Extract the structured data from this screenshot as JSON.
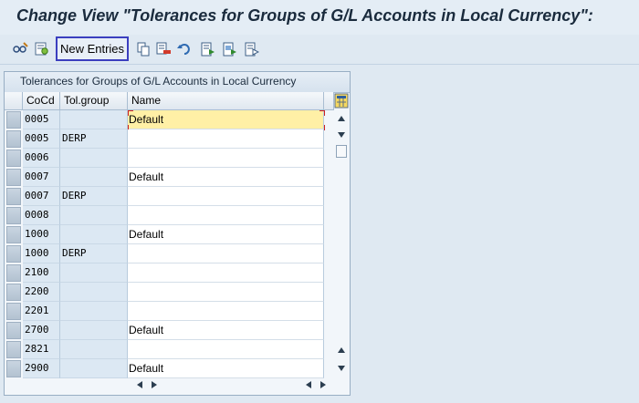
{
  "window": {
    "title": "Change View \"Tolerances for Groups of G/L Accounts in Local Currency\":"
  },
  "toolbar": {
    "new_entries_label": "New Entries",
    "icons": [
      "display-change-icon",
      "other-view-icon",
      "new-entries-button",
      "copy-icon",
      "delete-icon",
      "undo-icon",
      "select-all-icon",
      "select-block-icon",
      "deselect-all-icon"
    ]
  },
  "table": {
    "title": "Tolerances for Groups of G/L Accounts in Local Currency",
    "columns": [
      "CoCd",
      "Tol.group",
      "Name"
    ],
    "rows": [
      {
        "cocd": "0005",
        "tol_group": "",
        "name": "Default"
      },
      {
        "cocd": "0005",
        "tol_group": "DERP",
        "name": ""
      },
      {
        "cocd": "0006",
        "tol_group": "",
        "name": ""
      },
      {
        "cocd": "0007",
        "tol_group": "",
        "name": "Default"
      },
      {
        "cocd": "0007",
        "tol_group": "DERP",
        "name": ""
      },
      {
        "cocd": "0008",
        "tol_group": "",
        "name": ""
      },
      {
        "cocd": "1000",
        "tol_group": "",
        "name": "Default"
      },
      {
        "cocd": "1000",
        "tol_group": "DERP",
        "name": ""
      },
      {
        "cocd": "2100",
        "tol_group": "",
        "name": ""
      },
      {
        "cocd": "2200",
        "tol_group": "",
        "name": ""
      },
      {
        "cocd": "2201",
        "tol_group": "",
        "name": ""
      },
      {
        "cocd": "2700",
        "tol_group": "",
        "name": "Default"
      },
      {
        "cocd": "2821",
        "tol_group": "",
        "name": ""
      },
      {
        "cocd": "2900",
        "tol_group": "",
        "name": "Default"
      }
    ],
    "focused_row": 0
  },
  "colors": {
    "background": "#dfe9f2",
    "focus_highlight": "#fff0a6",
    "key_column_bg": "#dce8f3",
    "new_entries_border": "#3b3fbf"
  }
}
